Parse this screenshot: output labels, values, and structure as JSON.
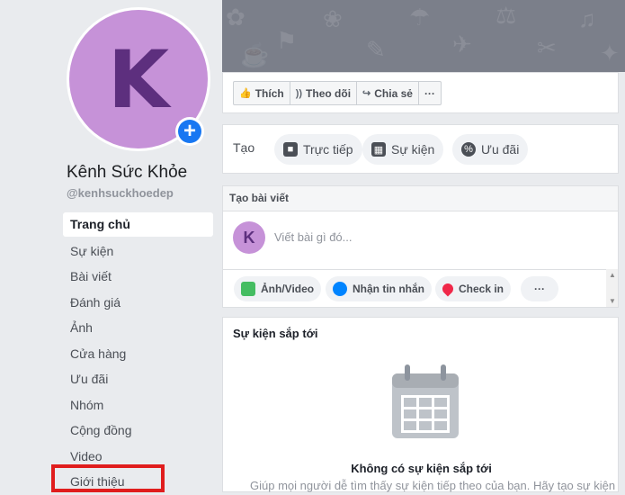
{
  "page": {
    "avatar_letter": "K",
    "name": "Kênh Sức Khỏe",
    "handle": "@kenhsuckhoedep"
  },
  "nav": {
    "items": [
      {
        "label": "Trang chủ",
        "active": true
      },
      {
        "label": "Sự kiện"
      },
      {
        "label": "Bài viết"
      },
      {
        "label": "Đánh giá"
      },
      {
        "label": "Ảnh"
      },
      {
        "label": "Cửa hàng"
      },
      {
        "label": "Ưu đãi"
      },
      {
        "label": "Nhóm"
      },
      {
        "label": "Cộng đồng"
      },
      {
        "label": "Video"
      },
      {
        "label": "Giới thiệu",
        "highlighted": true
      }
    ]
  },
  "actions": {
    "like": "Thích",
    "follow": "Theo dõi",
    "share": "Chia sẻ",
    "more": "···"
  },
  "create": {
    "label": "Tạo",
    "live": "Trực tiếp",
    "event": "Sự kiện",
    "offer": "Ưu đãi"
  },
  "composer": {
    "header": "Tạo bài viết",
    "avatar_letter": "K",
    "placeholder": "Viết bài gì đó...",
    "photo_video": "Ảnh/Video",
    "message": "Nhận tin nhắn",
    "checkin": "Check in",
    "more": "···"
  },
  "events": {
    "title": "Sự kiện sắp tới",
    "empty_title": "Không có sự kiện sắp tới",
    "empty_desc": "Giúp mọi người dễ tìm thấy sự kiện tiếp theo của bạn. Hãy tạo sự kiện"
  },
  "colors": {
    "brand_blue": "#1877f2",
    "avatar_bg": "#c692d8",
    "highlight_red": "#e01d1d"
  }
}
